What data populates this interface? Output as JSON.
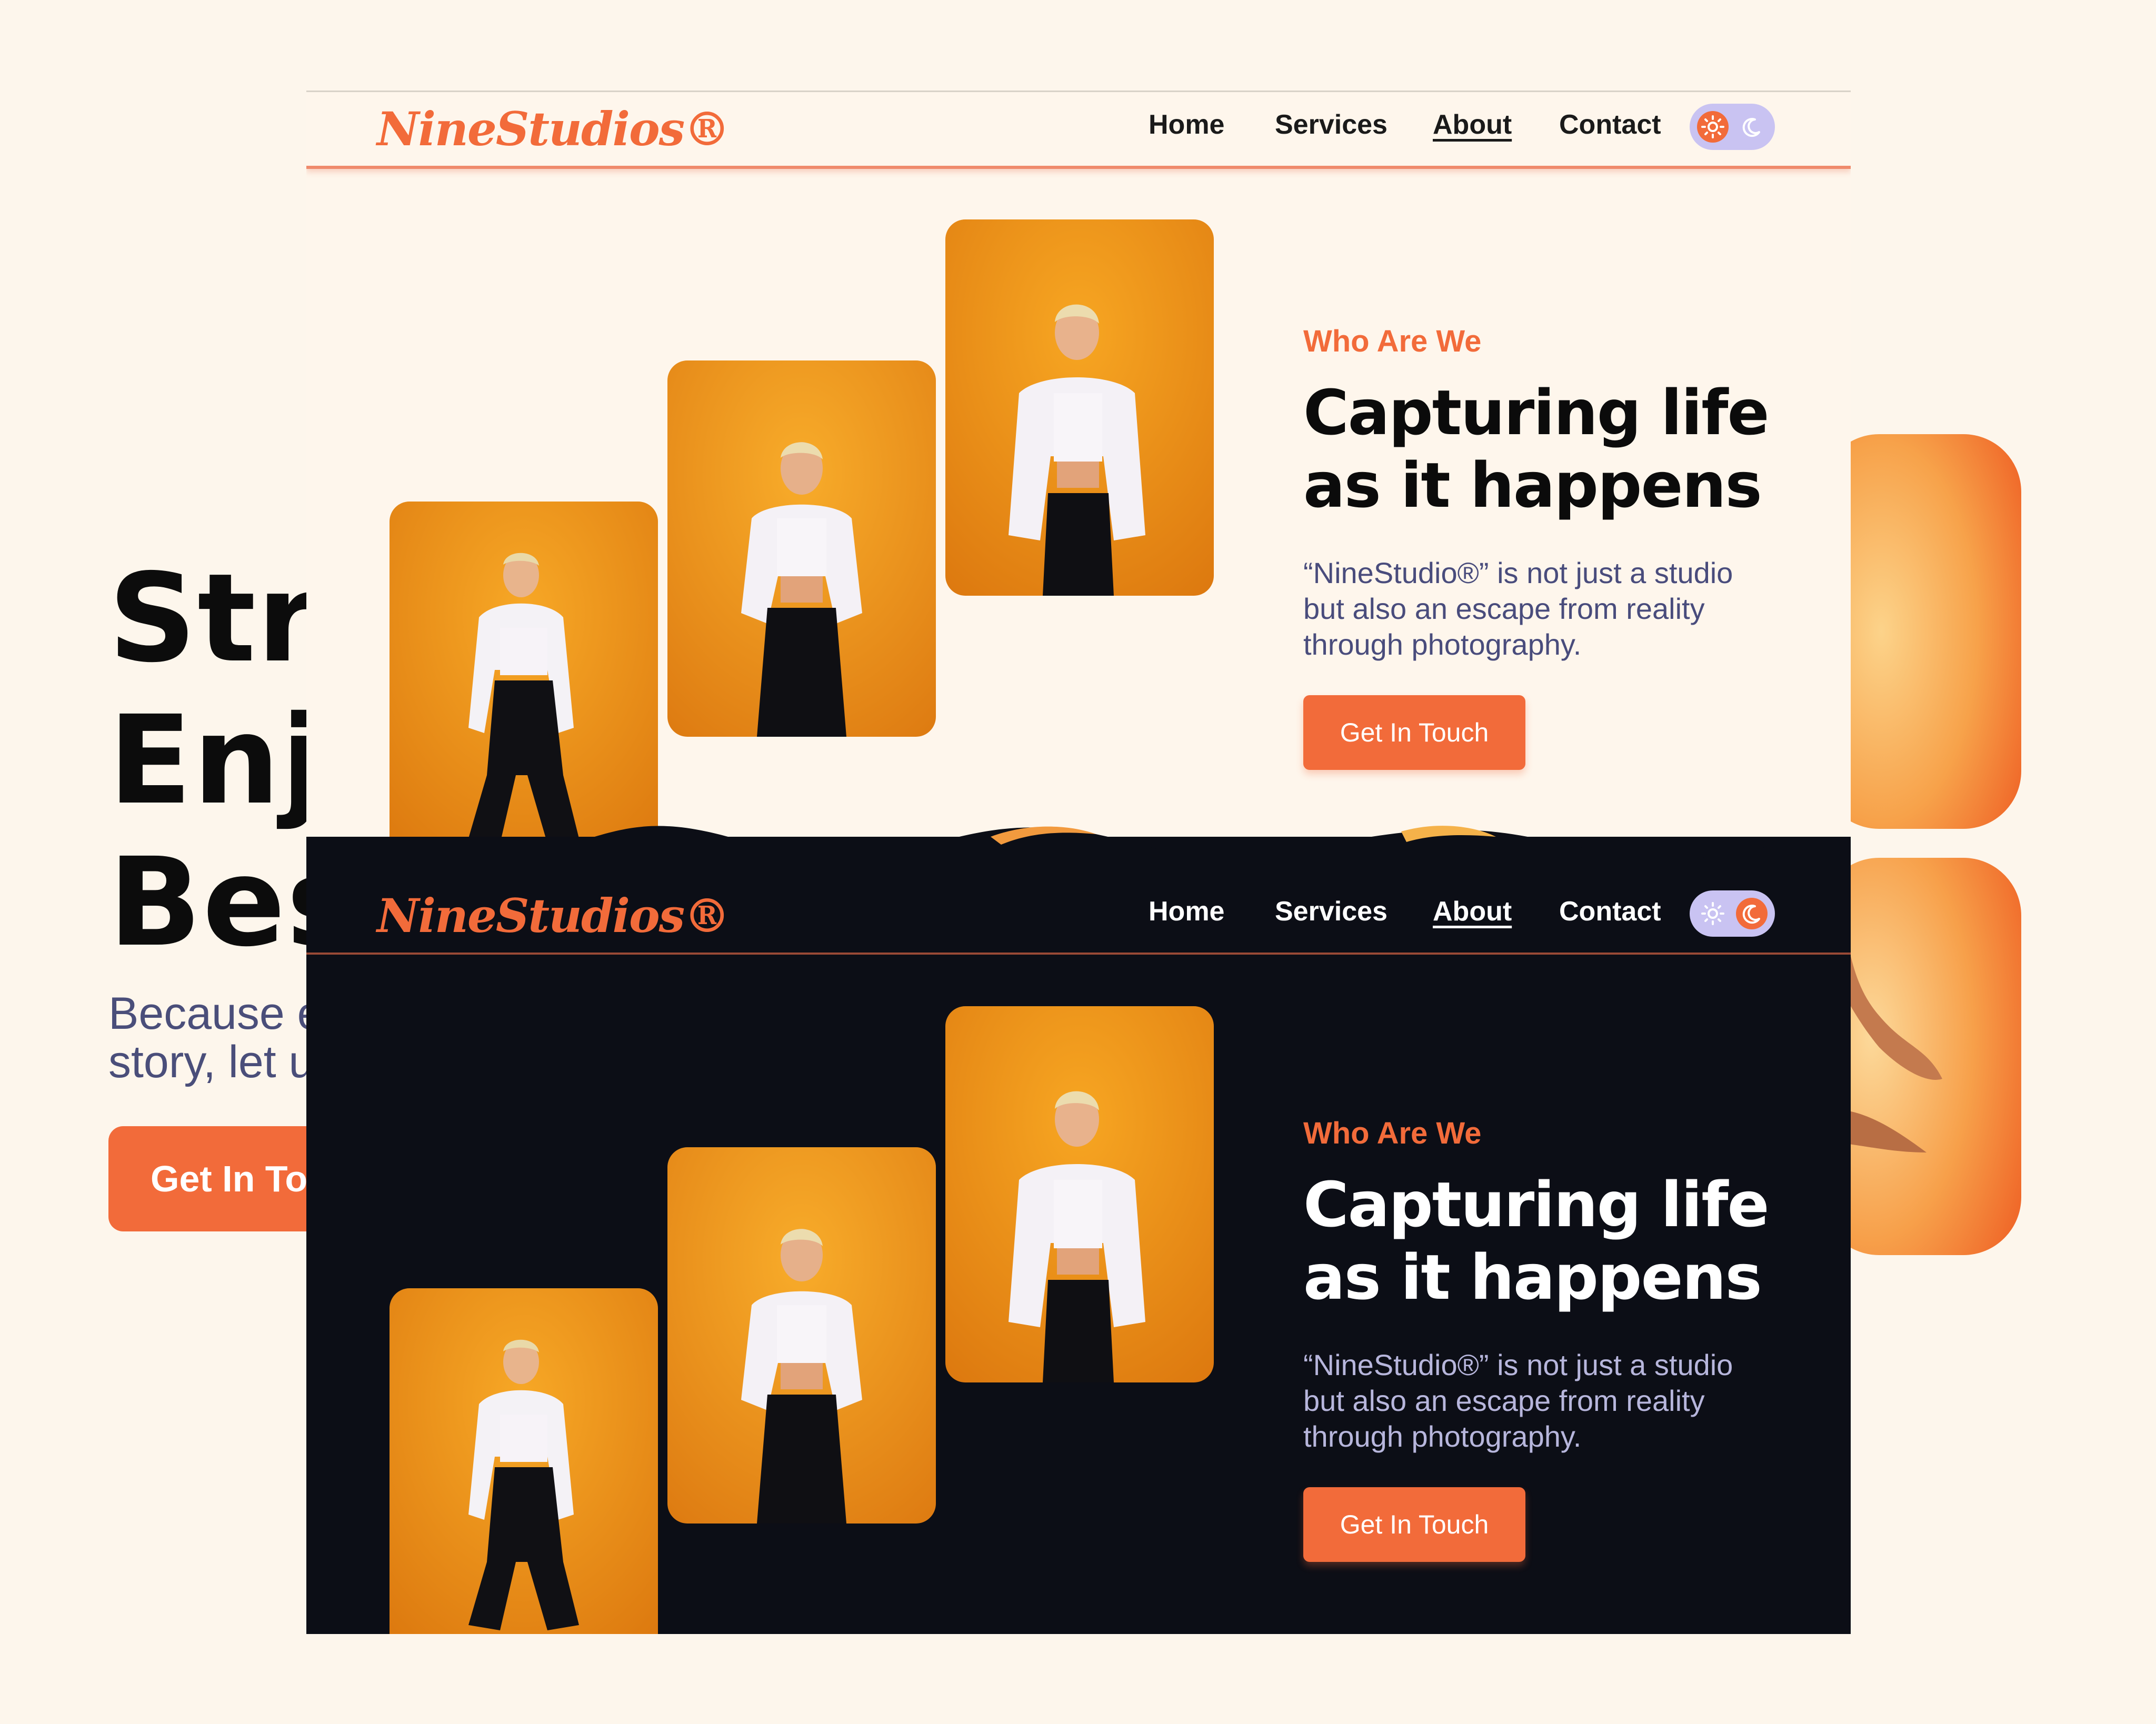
{
  "colors": {
    "accent": "#f26b3a",
    "page_background": "#fdf6ec",
    "dark_background": "#0c0e16",
    "toggle_track": "#c9c3f2",
    "heading_light": "#0b0b0b",
    "text_muted": "#494c7c"
  },
  "background_hero": {
    "title_lines": [
      "Str",
      "Enj",
      "Bes"
    ],
    "subtitle_lines": [
      "Because e",
      "story, let u"
    ],
    "button_label": "Get In To"
  },
  "light_theme": {
    "brand": "NineStudios®",
    "nav": {
      "home": "Home",
      "services": "Services",
      "about": "About",
      "contact": "Contact"
    },
    "theme_toggle": {
      "active": "sun-icon",
      "inactive": "moon-icon"
    },
    "eyebrow": "Who Are We",
    "headline_lines": [
      "Capturing life",
      "as it happens"
    ],
    "description_lines": [
      "“NineStudio®” is not just a studio",
      "but also an escape from reality",
      "through photography."
    ],
    "cta_label": "Get In Touch"
  },
  "dark_theme": {
    "brand": "NineStudios®",
    "nav": {
      "home": "Home",
      "services": "Services",
      "about": "About",
      "contact": "Contact"
    },
    "theme_toggle": {
      "active": "moon-icon",
      "inactive": "sun-icon"
    },
    "eyebrow": "Who Are We",
    "headline_lines": [
      "Capturing life",
      "as it happens"
    ],
    "description_lines": [
      "“NineStudio®” is not just a studio",
      "but also an escape from reality",
      "through photography."
    ],
    "cta_label": "Get In Touch"
  }
}
